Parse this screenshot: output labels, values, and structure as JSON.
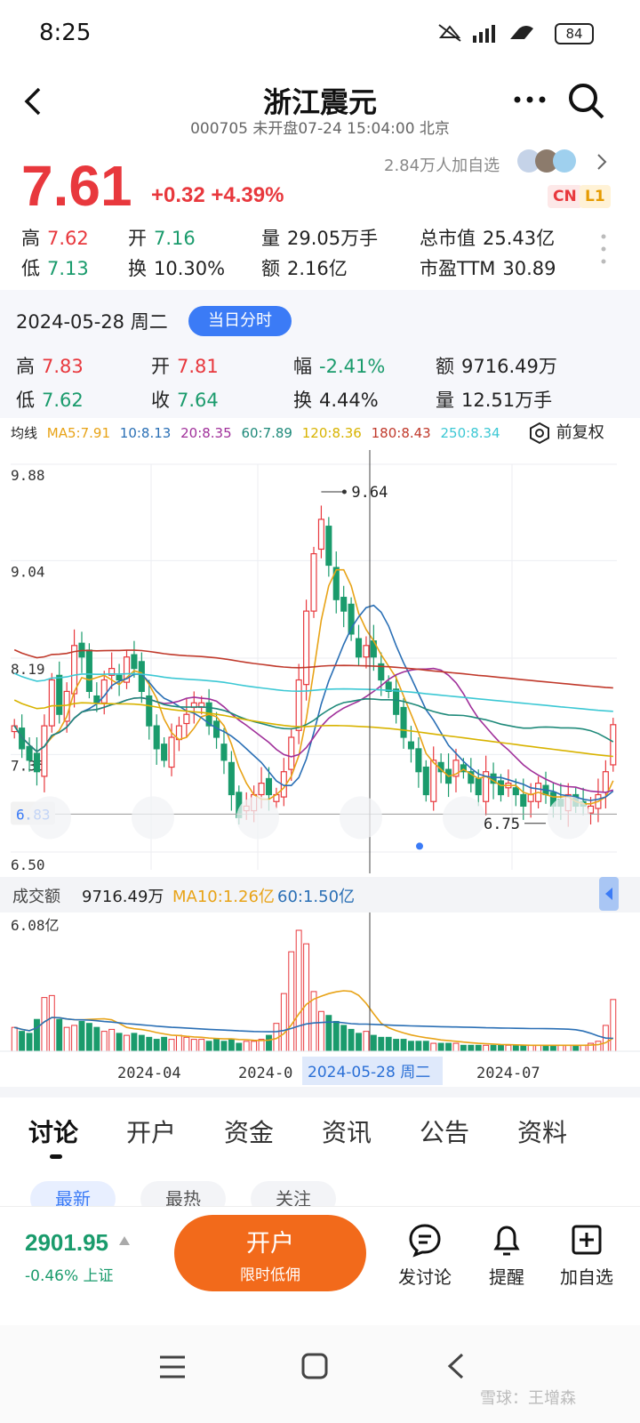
{
  "status": {
    "time": "8:25",
    "battery": "84"
  },
  "header": {
    "title": "浙江震元",
    "subtitle": "000705 未开盘07-24 15:04:00 北京",
    "followers": "2.84万人加自选",
    "badge_cn": "CN",
    "badge_l1": "L1"
  },
  "quote": {
    "price": "7.61",
    "change": "+0.32 +4.39%",
    "stats": [
      {
        "label": "高",
        "value": "7.62"
      },
      {
        "label": "开",
        "value": "7.16"
      },
      {
        "label": "量",
        "value": "29.05万手"
      },
      {
        "label": "总市值",
        "value": "25.43亿"
      },
      {
        "label": "低",
        "value": "7.13"
      },
      {
        "label": "换",
        "value": "10.30%"
      },
      {
        "label": "额",
        "value": "2.16亿"
      },
      {
        "label": "市盈TTM",
        "value": "30.89"
      }
    ]
  },
  "day": {
    "date": "2024-05-28 周二",
    "mode_button": "当日分时",
    "stats": [
      {
        "label": "高",
        "value": "7.83"
      },
      {
        "label": "开",
        "value": "7.81"
      },
      {
        "label": "幅",
        "value": "-2.41%"
      },
      {
        "label": "额",
        "value": "9716.49万"
      },
      {
        "label": "低",
        "value": "7.62"
      },
      {
        "label": "收",
        "value": "7.64"
      },
      {
        "label": "换",
        "value": "4.44%"
      },
      {
        "label": "量",
        "value": "12.51万手"
      }
    ]
  },
  "ma": {
    "label": "均线",
    "items": [
      {
        "text": "MA5:7.91",
        "color": "#e8a317"
      },
      {
        "text": "10:8.13",
        "color": "#2a6fb5"
      },
      {
        "text": "20:8.35",
        "color": "#a0309a"
      },
      {
        "text": "60:7.89",
        "color": "#1f8a7a"
      },
      {
        "text": "120:8.36",
        "color": "#d8b300"
      },
      {
        "text": "180:8.43",
        "color": "#c0392b"
      },
      {
        "text": "250:8.34",
        "color": "#3cc8d4"
      }
    ],
    "adjust": "前复权"
  },
  "chart_data": {
    "type": "candlestick",
    "price_axis_ticks": [
      "9.88",
      "9.04",
      "8.19",
      "7.35",
      "6.50"
    ],
    "last_price_marker": "6.83",
    "high_annotation": "9.64",
    "low_annotation": "6.75",
    "date_ticks": [
      "2024-04",
      "2024-0",
      "2024-07"
    ],
    "crosshair_date": "2024-05-28 周二",
    "ylim": [
      6.5,
      9.88
    ],
    "ma_lines": [
      {
        "name": "MA5",
        "color": "#e8a317"
      },
      {
        "name": "MA10",
        "color": "#2a6fb5"
      },
      {
        "name": "MA20",
        "color": "#a0309a"
      },
      {
        "name": "MA60",
        "color": "#1f8a7a"
      },
      {
        "name": "MA120",
        "color": "#d8b300"
      },
      {
        "name": "MA180",
        "color": "#c0392b"
      },
      {
        "name": "MA250",
        "color": "#3cc8d4"
      }
    ],
    "closes": [
      7.6,
      7.4,
      7.3,
      7.2,
      7.6,
      8.0,
      7.7,
      7.9,
      8.3,
      8.2,
      7.9,
      7.8,
      8.0,
      8.1,
      8.0,
      8.2,
      8.1,
      7.9,
      7.6,
      7.4,
      7.3,
      7.5,
      7.6,
      7.7,
      7.8,
      7.8,
      7.6,
      7.5,
      7.3,
      7.0,
      6.8,
      6.9,
      7.0,
      7.1,
      7.0,
      7.0,
      7.2,
      7.5,
      8.0,
      8.6,
      9.1,
      9.4,
      9.0,
      8.7,
      8.6,
      8.4,
      8.2,
      8.3,
      8.2,
      8.0,
      7.9,
      7.7,
      7.5,
      7.4,
      7.2,
      7.0,
      7.3,
      7.2,
      7.1,
      7.3,
      7.2,
      7.1,
      7.0,
      7.2,
      7.1,
      7.0,
      7.1,
      7.0,
      6.9,
      7.0,
      7.1,
      7.0,
      6.9,
      6.9,
      7.0,
      6.9,
      6.9,
      6.9,
      7.0,
      7.2,
      7.61
    ],
    "volume": {
      "header_label": "成交额",
      "value": "9716.49万",
      "ma10": "MA10:1.26亿",
      "ma60": "60:1.50亿",
      "axis_top": "6.08亿",
      "values": [
        1.2,
        1.0,
        0.9,
        1.6,
        2.7,
        2.8,
        1.6,
        1.2,
        1.3,
        1.5,
        1.4,
        1.2,
        1.0,
        1.1,
        0.9,
        0.8,
        0.9,
        0.8,
        0.7,
        0.6,
        0.7,
        0.6,
        0.8,
        0.7,
        0.6,
        0.6,
        0.5,
        0.6,
        0.5,
        0.6,
        0.4,
        0.5,
        0.5,
        0.6,
        0.8,
        1.4,
        2.9,
        5.0,
        6.08,
        5.4,
        3.0,
        2.0,
        1.8,
        1.5,
        1.3,
        1.1,
        0.9,
        1.0,
        0.8,
        0.7,
        0.7,
        0.6,
        0.6,
        0.5,
        0.5,
        0.5,
        0.4,
        0.4,
        0.4,
        0.4,
        0.3,
        0.3,
        0.3,
        0.3,
        0.3,
        0.3,
        0.3,
        0.3,
        0.3,
        0.3,
        0.3,
        0.3,
        0.3,
        0.3,
        0.3,
        0.3,
        0.3,
        0.4,
        0.5,
        1.3,
        2.6
      ]
    }
  },
  "tabs": [
    "讨论",
    "开户",
    "资金",
    "资讯",
    "公告",
    "资料"
  ],
  "subtabs": [
    "最新",
    "最热",
    "关注"
  ],
  "bottom": {
    "index_value": "2901.95",
    "index_change": "-0.46% 上证",
    "open_button": "开户",
    "open_sub": "限时低佣",
    "actions": [
      "发讨论",
      "提醒",
      "加自选"
    ]
  },
  "watermark": "雪球：王增森"
}
